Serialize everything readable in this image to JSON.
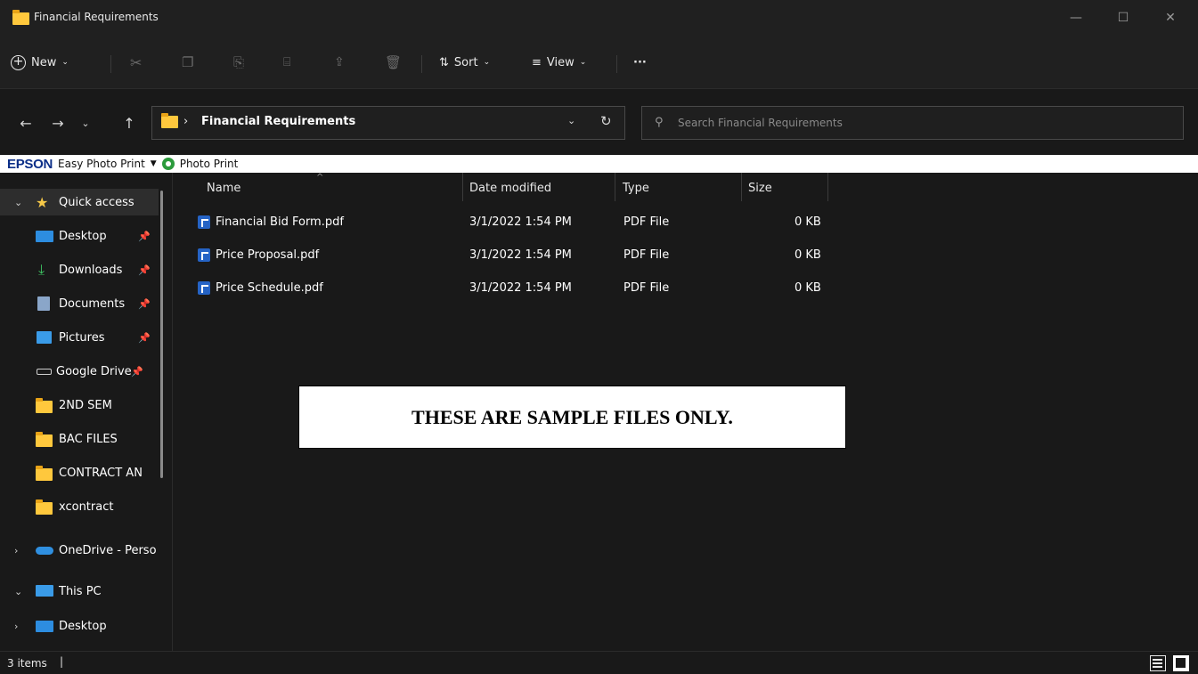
{
  "window": {
    "title": "Financial Requirements",
    "minimize": "—",
    "maximize": "☐",
    "close": "✕"
  },
  "toolbar": {
    "new_label": "New",
    "sort_label": "Sort",
    "view_label": "View",
    "more_label": "···"
  },
  "address": {
    "crumb": "Financial Requirements",
    "search_placeholder": "Search Financial Requirements"
  },
  "epson": {
    "logo": "EPSON",
    "easy_photo_print": "Easy Photo Print",
    "photo_print": "Photo Print"
  },
  "nav": {
    "quick_access": "Quick access",
    "items": [
      {
        "label": "Desktop",
        "icon": "desktop-icon"
      },
      {
        "label": "Downloads",
        "icon": "download-icon"
      },
      {
        "label": "Documents",
        "icon": "document-icon"
      },
      {
        "label": "Pictures",
        "icon": "pictures-icon"
      },
      {
        "label": "Google Drive",
        "icon": "drive-icon"
      },
      {
        "label": "2ND SEM",
        "icon": "folder-icon"
      },
      {
        "label": "BAC FILES",
        "icon": "folder-icon"
      },
      {
        "label": "CONTRACT AN",
        "icon": "folder-icon"
      },
      {
        "label": "xcontract",
        "icon": "folder-icon"
      }
    ],
    "onedrive": "OneDrive - Perso",
    "this_pc": "This PC",
    "pc_desktop": "Desktop"
  },
  "columns": {
    "name": "Name",
    "date_modified": "Date modified",
    "type": "Type",
    "size": "Size"
  },
  "files": [
    {
      "name": "Financial Bid Form.pdf",
      "date": "3/1/2022 1:54 PM",
      "type": "PDF File",
      "size": "0 KB"
    },
    {
      "name": "Price Proposal.pdf",
      "date": "3/1/2022 1:54 PM",
      "type": "PDF File",
      "size": "0 KB"
    },
    {
      "name": "Price Schedule.pdf",
      "date": "3/1/2022 1:54 PM",
      "type": "PDF File",
      "size": "0 KB"
    }
  ],
  "notice": "THESE ARE SAMPLE FILES ONLY.",
  "status": {
    "count": "3 items",
    "sep": "|"
  },
  "colors": {
    "background": "#191919",
    "chrome": "#202020",
    "folder": "#ffc83d",
    "pdf": "#2563c5",
    "epson_blue": "#0c2f88"
  }
}
